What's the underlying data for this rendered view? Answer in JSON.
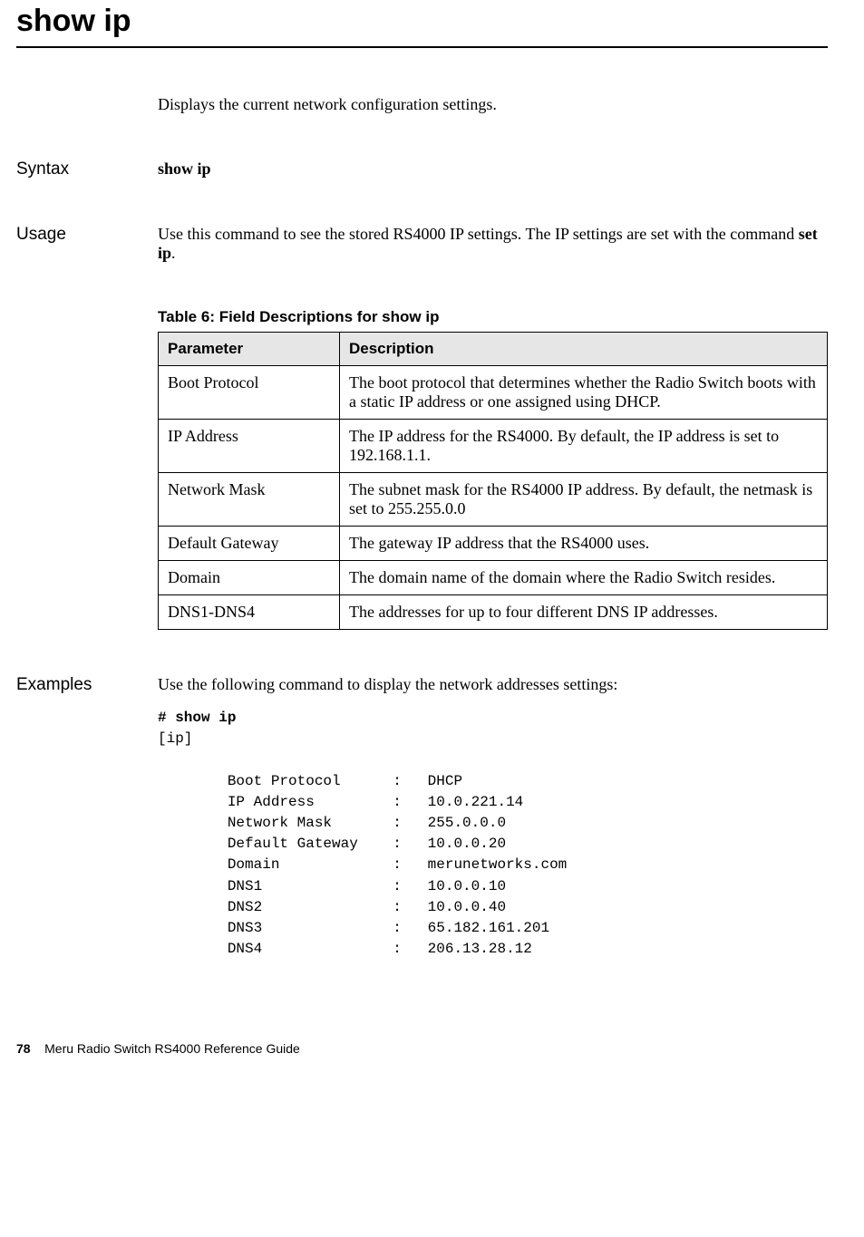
{
  "title": "show ip",
  "intro": "Displays the current network configuration settings.",
  "syntax": {
    "label": "Syntax",
    "command": "show ip"
  },
  "usage": {
    "label": "Usage",
    "text_before": "Use this command to see the stored RS4000 IP settings. The IP settings are set with the command ",
    "command": "set ip",
    "text_after": "."
  },
  "table": {
    "caption": "Table 6: Field Descriptions for show ip",
    "headers": {
      "param": "Parameter",
      "desc": "Description"
    },
    "rows": [
      {
        "param": "Boot Protocol",
        "desc": "The boot protocol that determines whether the Radio Switch boots with a static IP address or one assigned using DHCP."
      },
      {
        "param": "IP Address",
        "desc": "The IP address for the RS4000. By default, the IP address is set to 192.168.1.1."
      },
      {
        "param": "Network Mask",
        "desc": "The subnet mask for the RS4000 IP address. By default, the netmask is set to 255.255.0.0"
      },
      {
        "param": "Default Gateway",
        "desc": "The gateway IP address that the RS4000 uses."
      },
      {
        "param": "Domain",
        "desc": "The domain name of the domain where the Radio Switch resides."
      },
      {
        "param": "DNS1-DNS4",
        "desc": "The addresses for up to four different DNS IP addresses."
      }
    ]
  },
  "examples": {
    "label": "Examples",
    "intro": "Use the following command to display the network addresses settings:",
    "prompt_line": "# show ip",
    "output": "[ip]\n\n        Boot Protocol      :   DHCP\n        IP Address         :   10.0.221.14\n        Network Mask       :   255.0.0.0\n        Default Gateway    :   10.0.0.20\n        Domain             :   merunetworks.com\n        DNS1               :   10.0.0.10\n        DNS2               :   10.0.0.40\n        DNS3               :   65.182.161.201\n        DNS4               :   206.13.28.12"
  },
  "footer": {
    "page_number": "78",
    "book_title": "Meru Radio Switch RS4000 Reference Guide"
  }
}
